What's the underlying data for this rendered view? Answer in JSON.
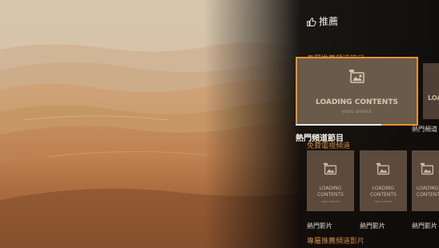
{
  "header": {
    "icon": "thumbs-up-icon",
    "title": "推薦"
  },
  "featured_row": {
    "title": "專屬推薦頻道節目",
    "cards": [
      {
        "label": "LOADING CONTENTS",
        "sub": "VIDEO SERVICE",
        "focused": true,
        "progress": 0.7
      },
      {
        "label": "LOA"
      }
    ],
    "card_captions": [
      "熱門頻道節目",
      "熱門頻道"
    ]
  },
  "free_row": {
    "title": "免費電視頻道",
    "cards": [
      {
        "label_line1": "LOADING",
        "label_line2": "CONTENTS",
        "sub": "VIDEO SERVICE",
        "caption": "熱門影片"
      },
      {
        "label_line1": "LOADING",
        "label_line2": "CONTENTS",
        "sub": "VIDEO SERVICE",
        "caption": "熱門影片"
      },
      {
        "label_line1": "LOADING",
        "label_line2": "CONTENTS",
        "sub": "",
        "caption": "熱門影片"
      }
    ]
  },
  "next_row": {
    "title": "專屬推薦頻道影片"
  },
  "colors": {
    "accent": "#e8922e",
    "section_title": "#c9853c",
    "text": "#f2efe9"
  },
  "icons": {
    "placeholder": "image-placeholder-icon"
  }
}
